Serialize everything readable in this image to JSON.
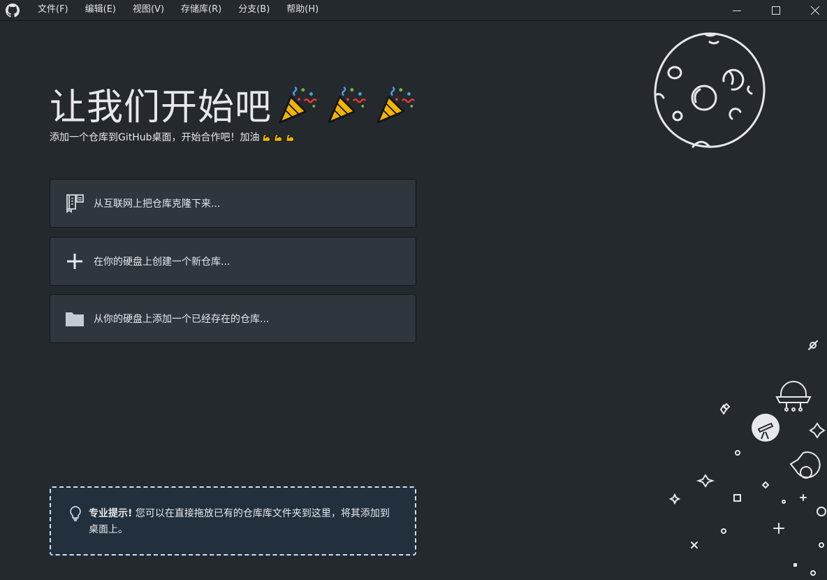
{
  "menu": {
    "items": [
      "文件(F)",
      "编辑(E)",
      "视图(V)",
      "存储库(R)",
      "分支(B)",
      "帮助(H)"
    ]
  },
  "hero": {
    "title": "让我们开始吧",
    "subtitle": "添加一个仓库到GitHub桌面，开始合作吧！加油"
  },
  "actions": {
    "clone": "从互联网上把仓库克隆下来...",
    "create": "在你的硬盘上创建一个新仓库...",
    "add": "从你的硬盘上添加一个已经存在的仓库..."
  },
  "tip": {
    "label": "专业提示!",
    "text": " 您可以在直接拖放已有的仓库库文件夹到这里，将其添加到桌面上。"
  },
  "icons": {
    "app": "github-icon",
    "party": "party-popper-icon",
    "muscle": "flexed-biceps-icon",
    "clone": "repo-clone-icon",
    "create": "plus-icon",
    "add": "folder-icon",
    "tip": "light-bulb-icon"
  },
  "colors": {
    "background": "#24292e",
    "card": "#2f363d",
    "tip_border": "#c8e1ff",
    "text": "#e6e8eb"
  }
}
